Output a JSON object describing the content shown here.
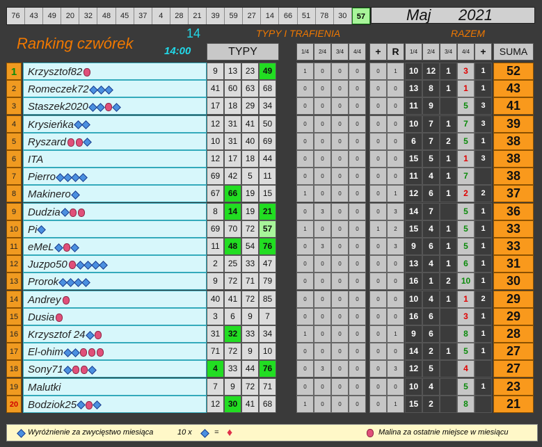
{
  "top_numbers": [
    "76",
    "43",
    "49",
    "20",
    "32",
    "48",
    "45",
    "37",
    "4",
    "28",
    "21",
    "39",
    "59",
    "27",
    "14",
    "66",
    "51",
    "78",
    "30",
    "57"
  ],
  "highlighted_number": "57",
  "month": "Maj",
  "year": "2021",
  "title": "Ranking czwórek",
  "draw_count": "14",
  "draw_time": "14:00",
  "header_typy_trafienia": "TYPY I TRAFIENIA",
  "header_razem": "RAZEM",
  "header_typy": "TYPY",
  "col_headers_mid": [
    "1/4",
    "2/4",
    "3/4",
    "4/4",
    "+",
    "R"
  ],
  "col_headers_razem": [
    "1/4",
    "2/4",
    "3/4",
    "4/4",
    "+"
  ],
  "header_suma": "SUMA",
  "colors": {
    "orange": "#f07800",
    "cyan": "#22d8e8",
    "green_hit": "#22dd22",
    "light_green_hit": "#a8f59a"
  },
  "rows": [
    {
      "rank": "1",
      "name": "Krzysztof82",
      "badges": [
        "ras"
      ],
      "typy": [
        "9",
        "13",
        "23",
        "49"
      ],
      "hits": [
        3
      ],
      "hitlight": [],
      "mid": [
        "1",
        "0",
        "0",
        "0",
        "0",
        "1"
      ],
      "rz": [
        "10",
        "12",
        "1",
        "3",
        "1"
      ],
      "suma": "52"
    },
    {
      "rank": "2",
      "name": "Romeczek72",
      "badges": [
        "dia",
        "dia",
        "dia"
      ],
      "typy": [
        "41",
        "60",
        "63",
        "68"
      ],
      "hits": [],
      "hitlight": [],
      "mid": [
        "0",
        "0",
        "0",
        "0",
        "0",
        "0"
      ],
      "rz": [
        "13",
        "8",
        "1",
        "1",
        "1"
      ],
      "suma": "43"
    },
    {
      "rank": "3",
      "name": "Staszek2020",
      "badges": [
        "dia",
        "dia",
        "ras",
        "dia"
      ],
      "typy": [
        "17",
        "18",
        "29",
        "34"
      ],
      "hits": [],
      "hitlight": [],
      "mid": [
        "0",
        "0",
        "0",
        "0",
        "0",
        "0"
      ],
      "rz": [
        "11",
        "9",
        "",
        "5",
        "3"
      ],
      "suma": "41"
    },
    {
      "rank": "4",
      "name": "Krysieńka",
      "badges": [
        "dia",
        "dia"
      ],
      "typy": [
        "12",
        "31",
        "41",
        "50"
      ],
      "hits": [],
      "hitlight": [],
      "mid": [
        "0",
        "0",
        "0",
        "0",
        "0",
        "0"
      ],
      "rz": [
        "10",
        "7",
        "1",
        "7",
        "3"
      ],
      "suma": "39"
    },
    {
      "rank": "5",
      "name": "Ryszard",
      "badges": [
        "ras",
        "ras",
        "dia"
      ],
      "typy": [
        "10",
        "31",
        "40",
        "69"
      ],
      "hits": [],
      "hitlight": [],
      "mid": [
        "0",
        "0",
        "0",
        "0",
        "0",
        "0"
      ],
      "rz": [
        "6",
        "7",
        "2",
        "5",
        "1"
      ],
      "suma": "38"
    },
    {
      "rank": "6",
      "name": "ITA",
      "badges": [],
      "typy": [
        "12",
        "17",
        "18",
        "44"
      ],
      "hits": [],
      "hitlight": [],
      "mid": [
        "0",
        "0",
        "0",
        "0",
        "0",
        "0"
      ],
      "rz": [
        "15",
        "5",
        "1",
        "1",
        "3"
      ],
      "suma": "38"
    },
    {
      "rank": "7",
      "name": "Pierro",
      "badges": [
        "dia",
        "dia",
        "dia",
        "dia"
      ],
      "typy": [
        "69",
        "42",
        "5",
        "11"
      ],
      "hits": [],
      "hitlight": [],
      "mid": [
        "0",
        "0",
        "0",
        "0",
        "0",
        "0"
      ],
      "rz": [
        "11",
        "4",
        "1",
        "7",
        ""
      ],
      "suma": "38"
    },
    {
      "rank": "8",
      "name": "Makinero",
      "badges": [
        "dia"
      ],
      "typy": [
        "67",
        "66",
        "19",
        "15"
      ],
      "hits": [
        1
      ],
      "hitlight": [],
      "mid": [
        "1",
        "0",
        "0",
        "0",
        "0",
        "1"
      ],
      "rz": [
        "12",
        "6",
        "1",
        "2",
        "2"
      ],
      "suma": "37"
    },
    {
      "rank": "9",
      "name": "Dudzia",
      "badges": [
        "dia",
        "ras",
        "ras"
      ],
      "typy": [
        "8",
        "14",
        "19",
        "21"
      ],
      "hits": [
        1,
        3
      ],
      "hitlight": [],
      "mid": [
        "0",
        "3",
        "0",
        "0",
        "0",
        "3"
      ],
      "rz": [
        "14",
        "7",
        "",
        "5",
        "1"
      ],
      "suma": "36"
    },
    {
      "rank": "10",
      "name": "Pi",
      "badges": [
        "dia"
      ],
      "typy": [
        "69",
        "70",
        "72",
        "57"
      ],
      "hits": [],
      "hitlight": [
        3
      ],
      "mid": [
        "1",
        "0",
        "0",
        "0",
        "1",
        "2"
      ],
      "rz": [
        "15",
        "4",
        "1",
        "5",
        "1"
      ],
      "suma": "33"
    },
    {
      "rank": "11",
      "name": "eMeL",
      "badges": [
        "dia",
        "ras",
        "dia"
      ],
      "typy": [
        "11",
        "48",
        "54",
        "76"
      ],
      "hits": [
        1,
        3
      ],
      "hitlight": [],
      "mid": [
        "0",
        "3",
        "0",
        "0",
        "0",
        "3"
      ],
      "rz": [
        "9",
        "6",
        "1",
        "5",
        "1"
      ],
      "suma": "33"
    },
    {
      "rank": "12",
      "name": "Juzpo50",
      "badges": [
        "ras",
        "dia",
        "dia",
        "dia",
        "dia"
      ],
      "typy": [
        "2",
        "25",
        "33",
        "47"
      ],
      "hits": [],
      "hitlight": [],
      "mid": [
        "0",
        "0",
        "0",
        "0",
        "0",
        "0"
      ],
      "rz": [
        "13",
        "4",
        "1",
        "6",
        "1"
      ],
      "suma": "31"
    },
    {
      "rank": "13",
      "name": "Prorok",
      "badges": [
        "dia",
        "dia",
        "dia",
        "dia"
      ],
      "typy": [
        "9",
        "72",
        "71",
        "79"
      ],
      "hits": [],
      "hitlight": [],
      "mid": [
        "0",
        "0",
        "0",
        "0",
        "0",
        "0"
      ],
      "rz": [
        "16",
        "1",
        "2",
        "10",
        "1"
      ],
      "suma": "30"
    },
    {
      "rank": "14",
      "name": "Andrey",
      "badges": [
        "ras"
      ],
      "typy": [
        "40",
        "41",
        "72",
        "85"
      ],
      "hits": [],
      "hitlight": [],
      "mid": [
        "0",
        "0",
        "0",
        "0",
        "0",
        "0"
      ],
      "rz": [
        "10",
        "4",
        "1",
        "1",
        "2"
      ],
      "suma": "29"
    },
    {
      "rank": "15",
      "name": "Dusia",
      "badges": [
        "ras"
      ],
      "typy": [
        "3",
        "6",
        "9",
        "7"
      ],
      "hits": [],
      "hitlight": [],
      "mid": [
        "0",
        "0",
        "0",
        "0",
        "0",
        "0"
      ],
      "rz": [
        "16",
        "6",
        "",
        "3",
        "1"
      ],
      "suma": "29"
    },
    {
      "rank": "16",
      "name": "Krzysztof 24",
      "badges": [
        "dia",
        "ras"
      ],
      "typy": [
        "31",
        "32",
        "33",
        "34"
      ],
      "hits": [
        1
      ],
      "hitlight": [],
      "mid": [
        "1",
        "0",
        "0",
        "0",
        "0",
        "1"
      ],
      "rz": [
        "9",
        "6",
        "",
        "8",
        "1"
      ],
      "suma": "28"
    },
    {
      "rank": "17",
      "name": "El-ohim",
      "badges": [
        "dia",
        "dia",
        "ras",
        "ras",
        "ras"
      ],
      "typy": [
        "71",
        "72",
        "9",
        "10"
      ],
      "hits": [],
      "hitlight": [],
      "mid": [
        "0",
        "0",
        "0",
        "0",
        "0",
        "0"
      ],
      "rz": [
        "14",
        "2",
        "1",
        "5",
        "1"
      ],
      "suma": "27"
    },
    {
      "rank": "18",
      "name": "Sony71",
      "badges": [
        "dia",
        "ras",
        "ras",
        "dia"
      ],
      "typy": [
        "4",
        "33",
        "44",
        "76"
      ],
      "hits": [
        0,
        3
      ],
      "hitlight": [],
      "mid": [
        "0",
        "3",
        "0",
        "0",
        "0",
        "3"
      ],
      "rz": [
        "12",
        "5",
        "",
        "4",
        ""
      ],
      "suma": "27"
    },
    {
      "rank": "19",
      "name": "Malutki",
      "badges": [],
      "typy": [
        "7",
        "9",
        "72",
        "71"
      ],
      "hits": [],
      "hitlight": [],
      "mid": [
        "0",
        "0",
        "0",
        "0",
        "0",
        "0"
      ],
      "rz": [
        "10",
        "4",
        "",
        "5",
        "1"
      ],
      "suma": "23"
    },
    {
      "rank": "20",
      "name": "Bodziok25",
      "badges": [
        "dia",
        "ras",
        "dia"
      ],
      "typy": [
        "12",
        "30",
        "41",
        "68"
      ],
      "hits": [
        1
      ],
      "hitlight": [],
      "mid": [
        "1",
        "0",
        "0",
        "0",
        "0",
        "1"
      ],
      "rz": [
        "15",
        "2",
        "",
        "8",
        ""
      ],
      "suma": "21"
    }
  ],
  "footer": {
    "left_text": "Wyróżnienie za zwycięstwo miesiąca",
    "multiplier": "10 x",
    "equals": "=",
    "right_text": "Malina za ostatnie miejsce w miesiącu"
  }
}
